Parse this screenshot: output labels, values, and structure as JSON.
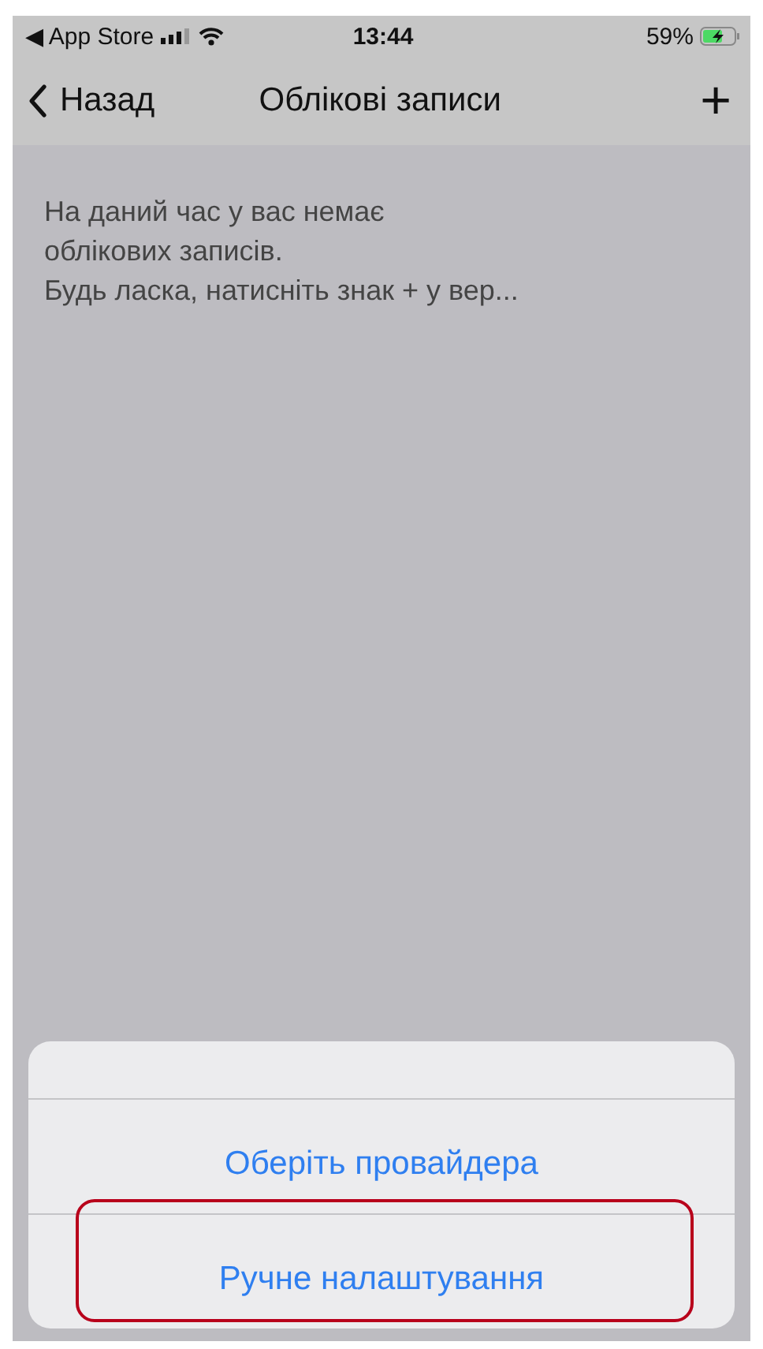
{
  "status_bar": {
    "back_app": "◀ App Store",
    "time": "13:44",
    "battery": "59%",
    "charging": true
  },
  "nav_bar": {
    "back": "Назад",
    "title": "Облікові записи",
    "add": "+"
  },
  "message": [
    "На даний час у вас немає",
    "облікових записів.",
    "Будь ласка, натисніть знак + у вер..."
  ],
  "action_sheet": {
    "options": [
      {
        "label": "Оберіть провайдера",
        "highlighted": false
      },
      {
        "label": "Ручне налаштування",
        "highlighted": true
      }
    ]
  }
}
